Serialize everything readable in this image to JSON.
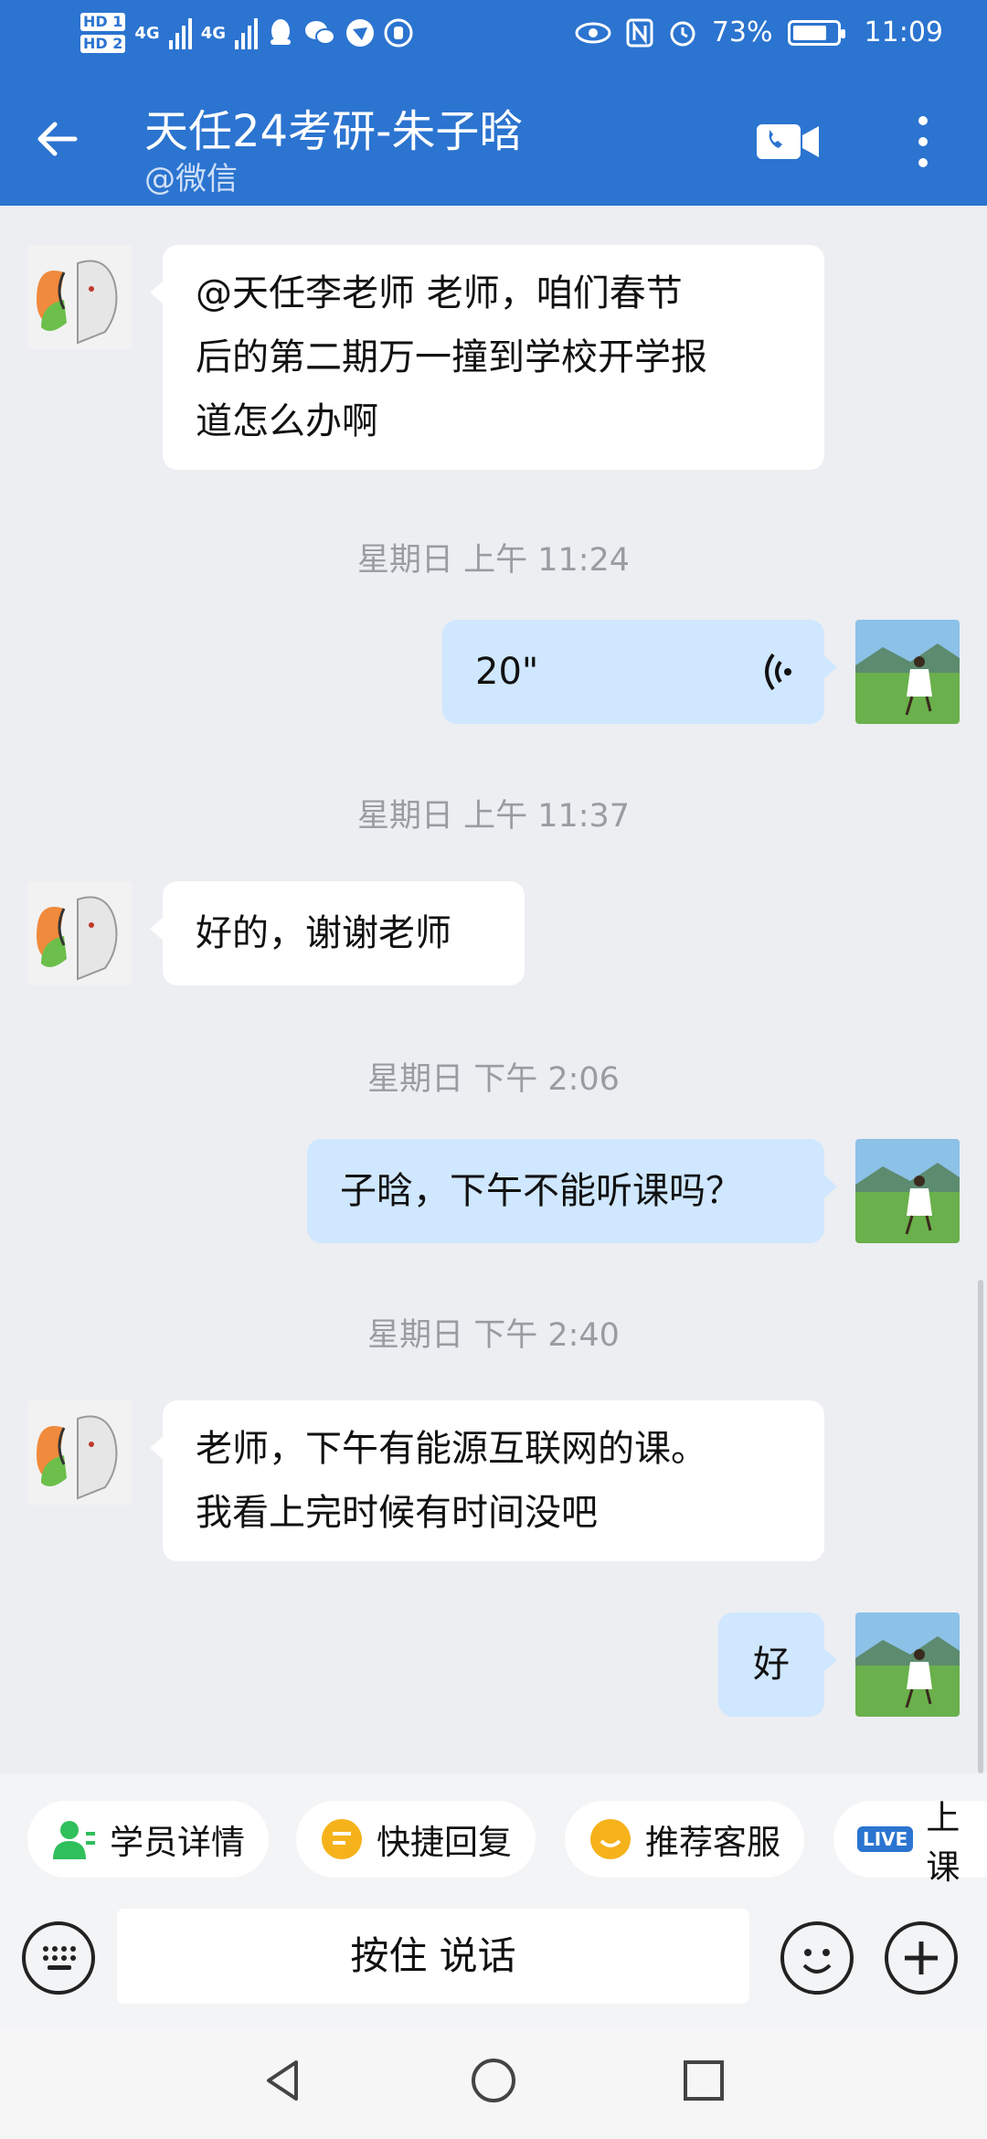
{
  "status_bar": {
    "hd1": "HD 1",
    "hd2": "HD 2",
    "net1": "4G",
    "net2": "4G",
    "battery": "73%",
    "time": "11:09"
  },
  "header": {
    "title": "天任24考研-朱子晗",
    "subtitle": "@微信"
  },
  "messages": [
    {
      "dir": "in",
      "text_lines": [
        "@天任李老师  老师，咱们春节",
        "后的第二期万一撞到学校开学报",
        "道怎么办啊"
      ]
    },
    {
      "time": "星期日  上午 11:24"
    },
    {
      "dir": "out",
      "voice_duration": "20\""
    },
    {
      "time": "星期日  上午 11:37"
    },
    {
      "dir": "in",
      "text_lines": [
        "好的，谢谢老师"
      ]
    },
    {
      "time": "星期日  下午 2:06"
    },
    {
      "dir": "out",
      "text_lines": [
        "子晗，下午不能听课吗？"
      ]
    },
    {
      "time": "星期日  下午 2:40"
    },
    {
      "dir": "in",
      "text_lines": [
        "老师，下午有能源互联网的课。",
        "我看上完时候有时间没吧"
      ]
    },
    {
      "dir": "out",
      "text_lines": [
        "好"
      ]
    }
  ],
  "quick_actions": [
    {
      "label": "学员详情",
      "icon": "student-icon",
      "color": "#2fbf5b"
    },
    {
      "label": "快捷回复",
      "icon": "quick-reply-icon",
      "color": "#f5b21a"
    },
    {
      "label": "推荐客服",
      "icon": "service-icon",
      "color": "#f5b21a"
    },
    {
      "label": "上课",
      "icon": "live-icon",
      "badge": "LIVE",
      "color": "#2b74d0"
    }
  ],
  "input": {
    "hold_to_talk": "按住 说话"
  },
  "colors": {
    "header_bg": "#2b74d0",
    "outgoing_bubble": "#cfe7ff",
    "incoming_bubble": "#ffffff",
    "chat_bg": "#eceef2"
  }
}
